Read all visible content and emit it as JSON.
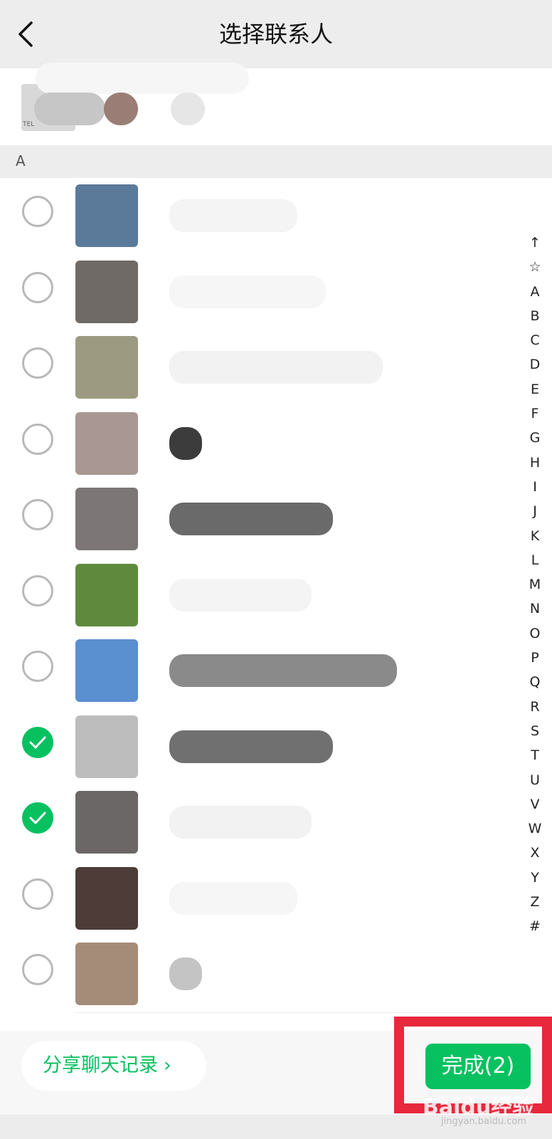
{
  "header": {
    "title": "选择联系人"
  },
  "section": {
    "letter": "A"
  },
  "contacts": [
    {
      "selected": false,
      "avatar_color": "#5b7a9a",
      "name_color": "#f4f4f4"
    },
    {
      "selected": false,
      "avatar_color": "#6f6a66",
      "name_color": "#f6f6f6"
    },
    {
      "selected": false,
      "avatar_color": "#9c9a80",
      "name_color": "#f2f2f2"
    },
    {
      "selected": false,
      "avatar_color": "#a89792",
      "name_color": "#3c3c3c"
    },
    {
      "selected": false,
      "avatar_color": "#7d7676",
      "name_color": "#6a6a6a"
    },
    {
      "selected": false,
      "avatar_color": "#5f8a3d",
      "name_color": "#f4f4f4"
    },
    {
      "selected": false,
      "avatar_color": "#5a8fd0",
      "name_color": "#8a8a8a"
    },
    {
      "selected": true,
      "avatar_color": "#bdbdbd",
      "name_color": "#707070"
    },
    {
      "selected": true,
      "avatar_color": "#6c6767",
      "name_color": "#f2f2f2"
    },
    {
      "selected": false,
      "avatar_color": "#4d3c38",
      "name_color": "#f6f6f6"
    },
    {
      "selected": false,
      "avatar_color": "#a48c78",
      "name_color": "#c4c4c4"
    }
  ],
  "alpha_index": [
    "↑",
    "☆",
    "A",
    "B",
    "C",
    "D",
    "E",
    "F",
    "G",
    "H",
    "I",
    "J",
    "K",
    "L",
    "M",
    "N",
    "O",
    "P",
    "Q",
    "R",
    "S",
    "T",
    "U",
    "V",
    "W",
    "X",
    "Y",
    "Z",
    "#"
  ],
  "bottom": {
    "share_label": "分享聊天记录",
    "share_chevron": "›",
    "done_label": "完成(2)"
  },
  "group_icon_text": "TEL",
  "watermark": {
    "text": "Baidu经验",
    "sub": "jingyan.baidu.com"
  },
  "colors": {
    "accent": "#07c160",
    "highlight": "#e8283c"
  }
}
